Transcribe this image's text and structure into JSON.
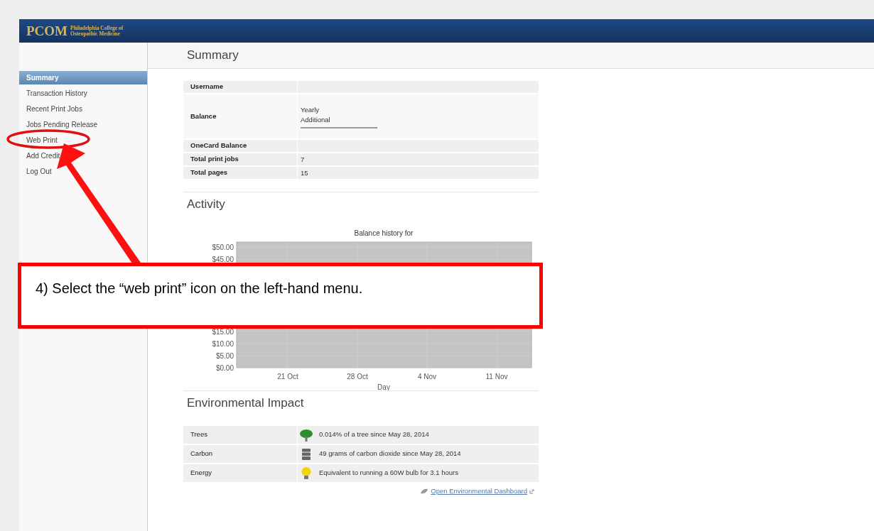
{
  "header": {
    "logo": "PCOM",
    "college": [
      "Philadelphia College of",
      "Osteopathic Medicine"
    ]
  },
  "sidebar": {
    "items": [
      {
        "label": "Summary",
        "selected": true
      },
      {
        "label": "Transaction History",
        "selected": false
      },
      {
        "label": "Recent Print Jobs",
        "selected": false
      },
      {
        "label": "Jobs Pending Release",
        "selected": false
      },
      {
        "label": "Web Print",
        "selected": false
      },
      {
        "label": "Add Credit",
        "selected": false
      },
      {
        "label": "Log Out",
        "selected": false
      }
    ]
  },
  "summary": {
    "title": "Summary",
    "rows": [
      {
        "label": "Username",
        "values": []
      },
      {
        "label": "Balance",
        "values": [
          "Yearly",
          "Additional"
        ]
      },
      {
        "label": "OneCard Balance",
        "values": []
      },
      {
        "label": "Total print jobs",
        "values": [
          "7"
        ]
      },
      {
        "label": "Total pages",
        "values": [
          "15"
        ]
      }
    ]
  },
  "activity": {
    "title": "Activity",
    "chart_data": {
      "type": "line",
      "title": "Balance history for",
      "xlabel": "Day",
      "ylim": [
        0,
        50
      ],
      "grid": true,
      "categories": [
        "21 Oct",
        "28 Oct",
        "4 Nov",
        "11 Nov"
      ],
      "yticks": [
        {
          "value": 0,
          "label": "$0.00"
        },
        {
          "value": 5,
          "label": "$5.00"
        },
        {
          "value": 10,
          "label": "$10.00"
        },
        {
          "value": 15,
          "label": "$15.00"
        },
        {
          "value": 45,
          "label": "$45.00"
        },
        {
          "value": 50,
          "label": "$50.00"
        }
      ]
    }
  },
  "environment": {
    "title": "Environmental Impact",
    "rows": [
      {
        "label": "Trees",
        "kind": "tree",
        "text": "0.014% of a tree since May 28, 2014"
      },
      {
        "label": "Carbon",
        "kind": "carbon",
        "text": "49 grams of carbon dioxide since May 28, 2014"
      },
      {
        "label": "Energy",
        "kind": "energy",
        "text": "Equivalent to running a 60W bulb for 3.1 hours"
      }
    ],
    "link": "Open Environmental Dashboard"
  },
  "callout": {
    "text": "4) Select the “web print” icon on the left-hand menu."
  }
}
